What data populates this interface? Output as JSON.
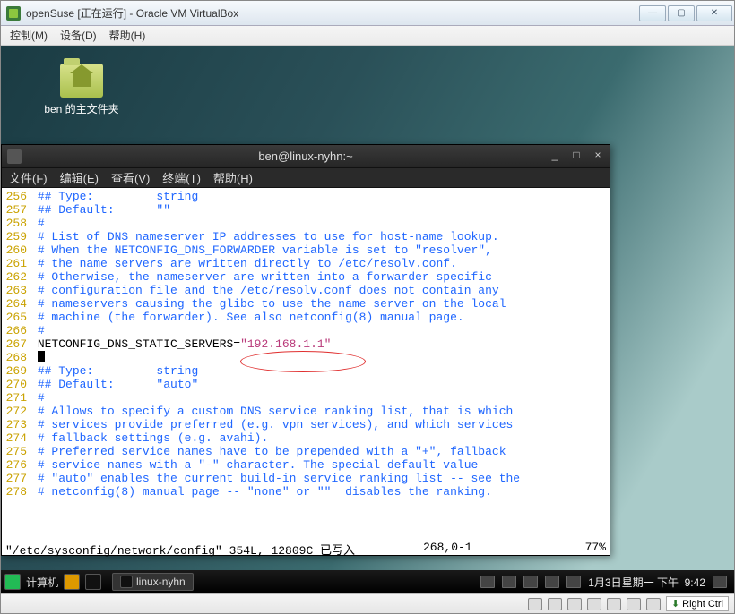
{
  "windowsWindow": {
    "title": "openSuse [正在运行] - Oracle VM VirtualBox",
    "menus": [
      "控制(M)",
      "设备(D)",
      "帮助(H)"
    ]
  },
  "desktopIcon": {
    "label": "ben 的主文件夹"
  },
  "terminal": {
    "title": "ben@linux-nyhn:~",
    "menus": [
      "文件(F)",
      "编辑(E)",
      "查看(V)",
      "终端(T)",
      "帮助(H)"
    ],
    "lines": [
      {
        "n": "256",
        "segs": [
          {
            "c": "comment",
            "t": "## Type:         string"
          }
        ]
      },
      {
        "n": "257",
        "segs": [
          {
            "c": "comment",
            "t": "## Default:      \"\""
          }
        ]
      },
      {
        "n": "258",
        "segs": [
          {
            "c": "comment",
            "t": "#"
          }
        ]
      },
      {
        "n": "259",
        "segs": [
          {
            "c": "comment",
            "t": "# List of DNS nameserver IP addresses to use for host-name lookup."
          }
        ]
      },
      {
        "n": "260",
        "segs": [
          {
            "c": "comment",
            "t": "# When the NETCONFIG_DNS_FORWARDER variable is set to \"resolver\","
          }
        ]
      },
      {
        "n": "261",
        "segs": [
          {
            "c": "comment",
            "t": "# the name servers are written directly to /etc/resolv.conf."
          }
        ]
      },
      {
        "n": "262",
        "segs": [
          {
            "c": "comment",
            "t": "# Otherwise, the nameserver are written into a forwarder specific"
          }
        ]
      },
      {
        "n": "263",
        "segs": [
          {
            "c": "comment",
            "t": "# configuration file and the /etc/resolv.conf does not contain any"
          }
        ]
      },
      {
        "n": "264",
        "segs": [
          {
            "c": "comment",
            "t": "# nameservers causing the glibc to use the name server on the local"
          }
        ]
      },
      {
        "n": "265",
        "segs": [
          {
            "c": "comment",
            "t": "# machine (the forwarder). See also netconfig(8) manual page."
          }
        ]
      },
      {
        "n": "266",
        "segs": [
          {
            "c": "comment",
            "t": "#"
          }
        ]
      },
      {
        "n": "267",
        "segs": [
          {
            "c": "plain",
            "t": "NETCONFIG_DNS_STATIC_SERVERS="
          },
          {
            "c": "str",
            "t": "\"192.168.1.1\""
          }
        ]
      },
      {
        "n": "268",
        "segs": [
          {
            "c": "cursor",
            "t": ""
          }
        ]
      },
      {
        "n": "269",
        "segs": [
          {
            "c": "comment",
            "t": "## Type:         string"
          }
        ]
      },
      {
        "n": "270",
        "segs": [
          {
            "c": "comment",
            "t": "## Default:      \"auto\""
          }
        ]
      },
      {
        "n": "271",
        "segs": [
          {
            "c": "comment",
            "t": "#"
          }
        ]
      },
      {
        "n": "272",
        "segs": [
          {
            "c": "comment",
            "t": "# Allows to specify a custom DNS service ranking list, that is which"
          }
        ]
      },
      {
        "n": "273",
        "segs": [
          {
            "c": "comment",
            "t": "# services provide preferred (e.g. vpn services), and which services"
          }
        ]
      },
      {
        "n": "274",
        "segs": [
          {
            "c": "comment",
            "t": "# fallback settings (e.g. avahi)."
          }
        ]
      },
      {
        "n": "275",
        "segs": [
          {
            "c": "comment",
            "t": "# Preferred service names have to be prepended with a \"+\", fallback"
          }
        ]
      },
      {
        "n": "276",
        "segs": [
          {
            "c": "comment",
            "t": "# service names with a \"-\" character. The special default value"
          }
        ]
      },
      {
        "n": "277",
        "segs": [
          {
            "c": "comment",
            "t": "# \"auto\" enables the current build-in service ranking list -- see the"
          }
        ]
      },
      {
        "n": "278",
        "segs": [
          {
            "c": "comment",
            "t": "# netconfig(8) manual page -- \"none\" or \"\"  disables the ranking."
          }
        ]
      }
    ],
    "status": {
      "left": "\"/etc/sysconfig/network/config\" 354L, 12809C 已写入",
      "mid": "268,0-1",
      "right": "77%"
    }
  },
  "susePanel": {
    "computerLabel": "计算机",
    "taskLabel": "linux-nyhn",
    "clock": "1月3日星期一 下午  9:42"
  },
  "vbStatus": {
    "hostkey": "Right Ctrl"
  }
}
